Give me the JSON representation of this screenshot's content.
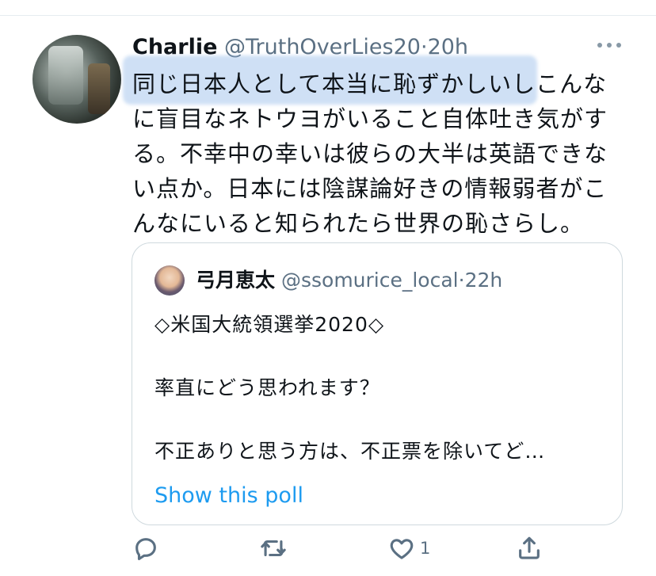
{
  "tweet": {
    "author_name": "Charlie",
    "handle": "@TruthOverLies20",
    "separator": "·",
    "time": "20h",
    "text": "同じ日本人として本当に恥ずかしいしこんな\nに盲目なネトウヨがいること自体吐き気がす\nる。不幸中の幸いは彼らの大半は英語できな\nい点か。日本には陰謀論好きの情報弱者がこ\nんなにいると知られたら世界の恥さらし。"
  },
  "quoted": {
    "author_name": "弓月恵太",
    "handle": "@ssomurice_local",
    "separator": "·",
    "time": "22h",
    "line1": "◇米国大統領選挙2020◇",
    "line2": "率直にどう思われます？",
    "line3": "不正ありと思う方は、不正票を除いてど…",
    "poll_link": "Show this poll"
  },
  "actions": {
    "reply_icon": "reply-icon",
    "retweet_icon": "retweet-icon",
    "like_icon": "like-icon",
    "like_count": "1",
    "share_icon": "share-icon"
  },
  "colors": {
    "highlight": "#95bbe8",
    "link": "#1d9bf0",
    "muted": "#5b7083"
  }
}
